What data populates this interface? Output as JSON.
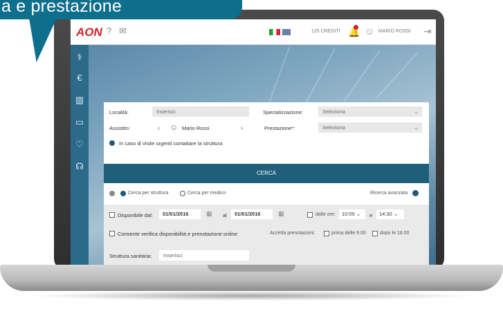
{
  "callout": {
    "text": "a e prestazione"
  },
  "topbar": {
    "logo": "AON",
    "credits": "125 CREDITI",
    "user_name": "MARIO ROSSI",
    "icons": [
      "help-icon",
      "mail-icon",
      "bell-icon",
      "user-icon",
      "logout-icon"
    ]
  },
  "sidebar": {
    "icons": [
      "stethoscope-icon",
      "euro-icon",
      "chart-icon",
      "document-icon",
      "heart-icon",
      "headset-icon"
    ]
  },
  "form": {
    "localita_label": "Località:",
    "localita_placeholder": "Inserisci",
    "specializzazione_label": "Specializzazione:",
    "specializzazione_value": "Seleziona",
    "assistito_label": "Assistito:",
    "assistito_name": "Mario Rossi",
    "prestazione_label": "Prestazione*:",
    "prestazione_value": "Seleziona",
    "info_text": "In caso di visite urgenti contattare la struttura",
    "search_button": "CERCA",
    "radio_struttura": "Cerca per struttura",
    "radio_medico": "Cerca per medico",
    "ricerca_avanzata": "Ricerca avanzata",
    "disponibile_label": "Disponibile dal:",
    "date_from": "01/01/2016",
    "al_label": "al",
    "date_to": "01/01/2016",
    "ore_label": "dalle ore:",
    "time_from": "10:00",
    "e_label": "e",
    "time_to": "14:30",
    "consenti_label": "Consente verifica disponibilità e prenotazione online",
    "accetta_label": "Accetta prenotazioni:",
    "prima_label": "prima delle 9.00",
    "dopo_label": "dopo le 18.00",
    "struttura_label": "Struttura sanitaria:",
    "struttura_placeholder": "Inserisci"
  }
}
